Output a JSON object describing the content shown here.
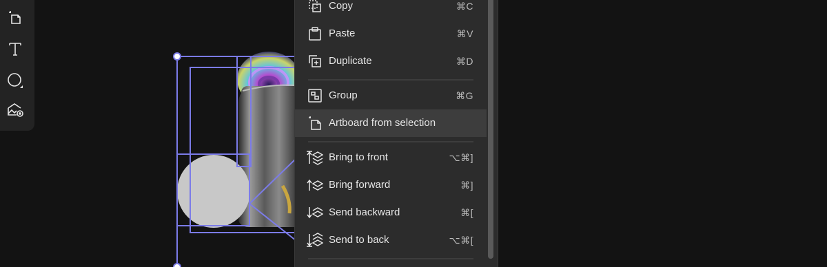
{
  "toolbar": {
    "tools": [
      {
        "icon": "artboard-icon"
      },
      {
        "icon": "text-icon"
      },
      {
        "icon": "ellipse-icon"
      },
      {
        "icon": "add-image-icon"
      }
    ]
  },
  "context_menu": {
    "items": [
      {
        "label": "Copy",
        "shortcut": "⌘C",
        "icon": "copy-icon"
      },
      {
        "label": "Paste",
        "shortcut": "⌘V",
        "icon": "paste-icon"
      },
      {
        "label": "Duplicate",
        "shortcut": "⌘D",
        "icon": "duplicate-icon"
      },
      {
        "label": "Group",
        "shortcut": "⌘G",
        "icon": "group-icon"
      },
      {
        "label": "Artboard from selection",
        "shortcut": "",
        "icon": "artboard-icon",
        "highlighted": true
      },
      {
        "label": "Bring to front",
        "shortcut": "⌥⌘]",
        "icon": "bring-to-front-icon"
      },
      {
        "label": "Bring forward",
        "shortcut": "⌘]",
        "icon": "bring-forward-icon"
      },
      {
        "label": "Send backward",
        "shortcut": "⌘[",
        "icon": "send-backward-icon"
      },
      {
        "label": "Send to back",
        "shortcut": "⌥⌘[",
        "icon": "send-to-back-icon"
      }
    ]
  },
  "colors": {
    "selection": "#7b7be8",
    "menu_bg": "#2c2c2c",
    "highlight": "#3d3d3d",
    "shape_fill": "#c8c8c8"
  }
}
